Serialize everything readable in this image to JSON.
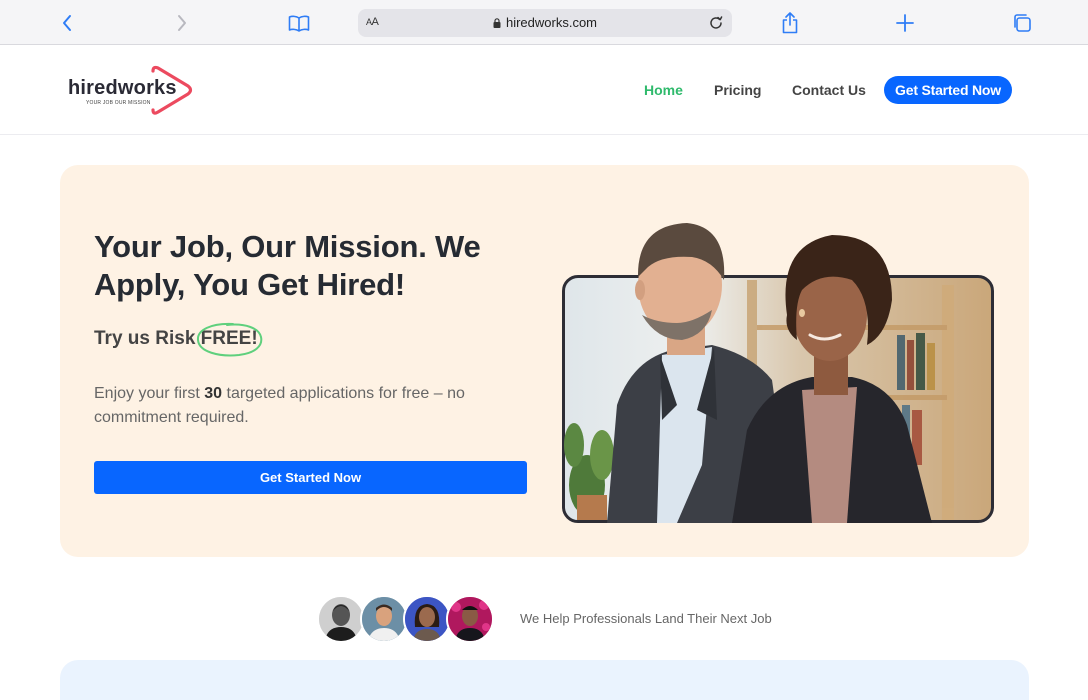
{
  "browser": {
    "address_aa": "AA",
    "url": "hiredworks.com"
  },
  "site": {
    "logo_word": "hiredworks",
    "logo_tagline": "YOUR JOB OUR MISSION",
    "nav": {
      "home": "Home",
      "pricing": "Pricing",
      "contact": "Contact Us",
      "cta": "Get Started Now"
    },
    "colors": {
      "accent_blue": "#0866ff",
      "active_green": "#2fba6c",
      "hero_bg": "#fef2e4",
      "logo_red": "#ec4a5f"
    }
  },
  "hero": {
    "title": "Your Job, Our Mission. We Apply, You Get Hired!",
    "sub_prefix": "Try us Risk ",
    "sub_highlight": "FREE!",
    "desc_prefix": "Enjoy your first ",
    "desc_number": "30",
    "desc_suffix": " targeted applications for free – no commitment required.",
    "cta": "Get Started Now"
  },
  "proof": {
    "text": "We Help Professionals Land Their Next Job"
  }
}
